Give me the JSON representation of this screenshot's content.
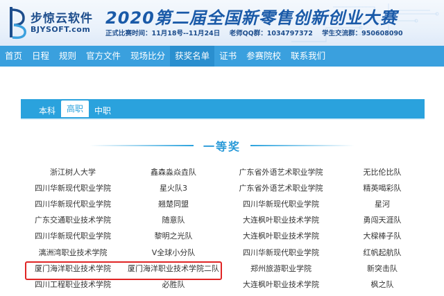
{
  "header": {
    "logo_name": "步惊云软件",
    "logo_url": "BJYSOFT.com",
    "title": "2020第二届全国新零售创新创业大赛",
    "info": [
      "正式比赛时间：11月18号--11月24日",
      "老师QQ群：1034797372",
      "学生交流群：950608090"
    ]
  },
  "nav": {
    "items": [
      "首页",
      "日程",
      "规则",
      "官方文件",
      "现场比分",
      "获奖名单",
      "证书",
      "参赛院校",
      "联系我们"
    ],
    "active_index": 5
  },
  "tabs": {
    "items": [
      "本科",
      "高职",
      "中职"
    ],
    "active_index": 1
  },
  "award": {
    "title": "一等奖"
  },
  "winners": [
    [
      "浙江树人大学",
      "鑫森淼焱垚队",
      "广东省外语艺术职业学院",
      "无比伦比队"
    ],
    [
      "四川华新现代职业学院",
      "星火队3",
      "广东省外语艺术职业学院",
      "精英喝彩队"
    ],
    [
      "四川华新现代职业学院",
      "翘楚同盟",
      "四川华新现代职业学院",
      "星河"
    ],
    [
      "广东交通职业技术学院",
      "随意队",
      "大连枫叶职业技术学院",
      "勇闯天涯队"
    ],
    [
      "四川华新现代职业学院",
      "黎明之光队",
      "大连枫叶职业技术学院",
      "大樑棒子队"
    ],
    [
      "漓洲湾职业技术学院",
      "V全球小分队",
      "四川华新现代职业学院",
      "红帆起航队"
    ],
    [
      "厦门海洋职业技术学院",
      "厦门海洋职业技术学院二队",
      "郑州旅游职业学院",
      "新突击队"
    ],
    [
      "四川工程职业技术学院",
      "必胜队",
      "大连枫叶职业技术学院",
      "枫之队"
    ]
  ],
  "colors": {
    "nav_bg": "#3aa0de",
    "tab_bg": "#2aa2dd",
    "title_blue": "#1a5aa8",
    "highlight": "#e02424"
  }
}
